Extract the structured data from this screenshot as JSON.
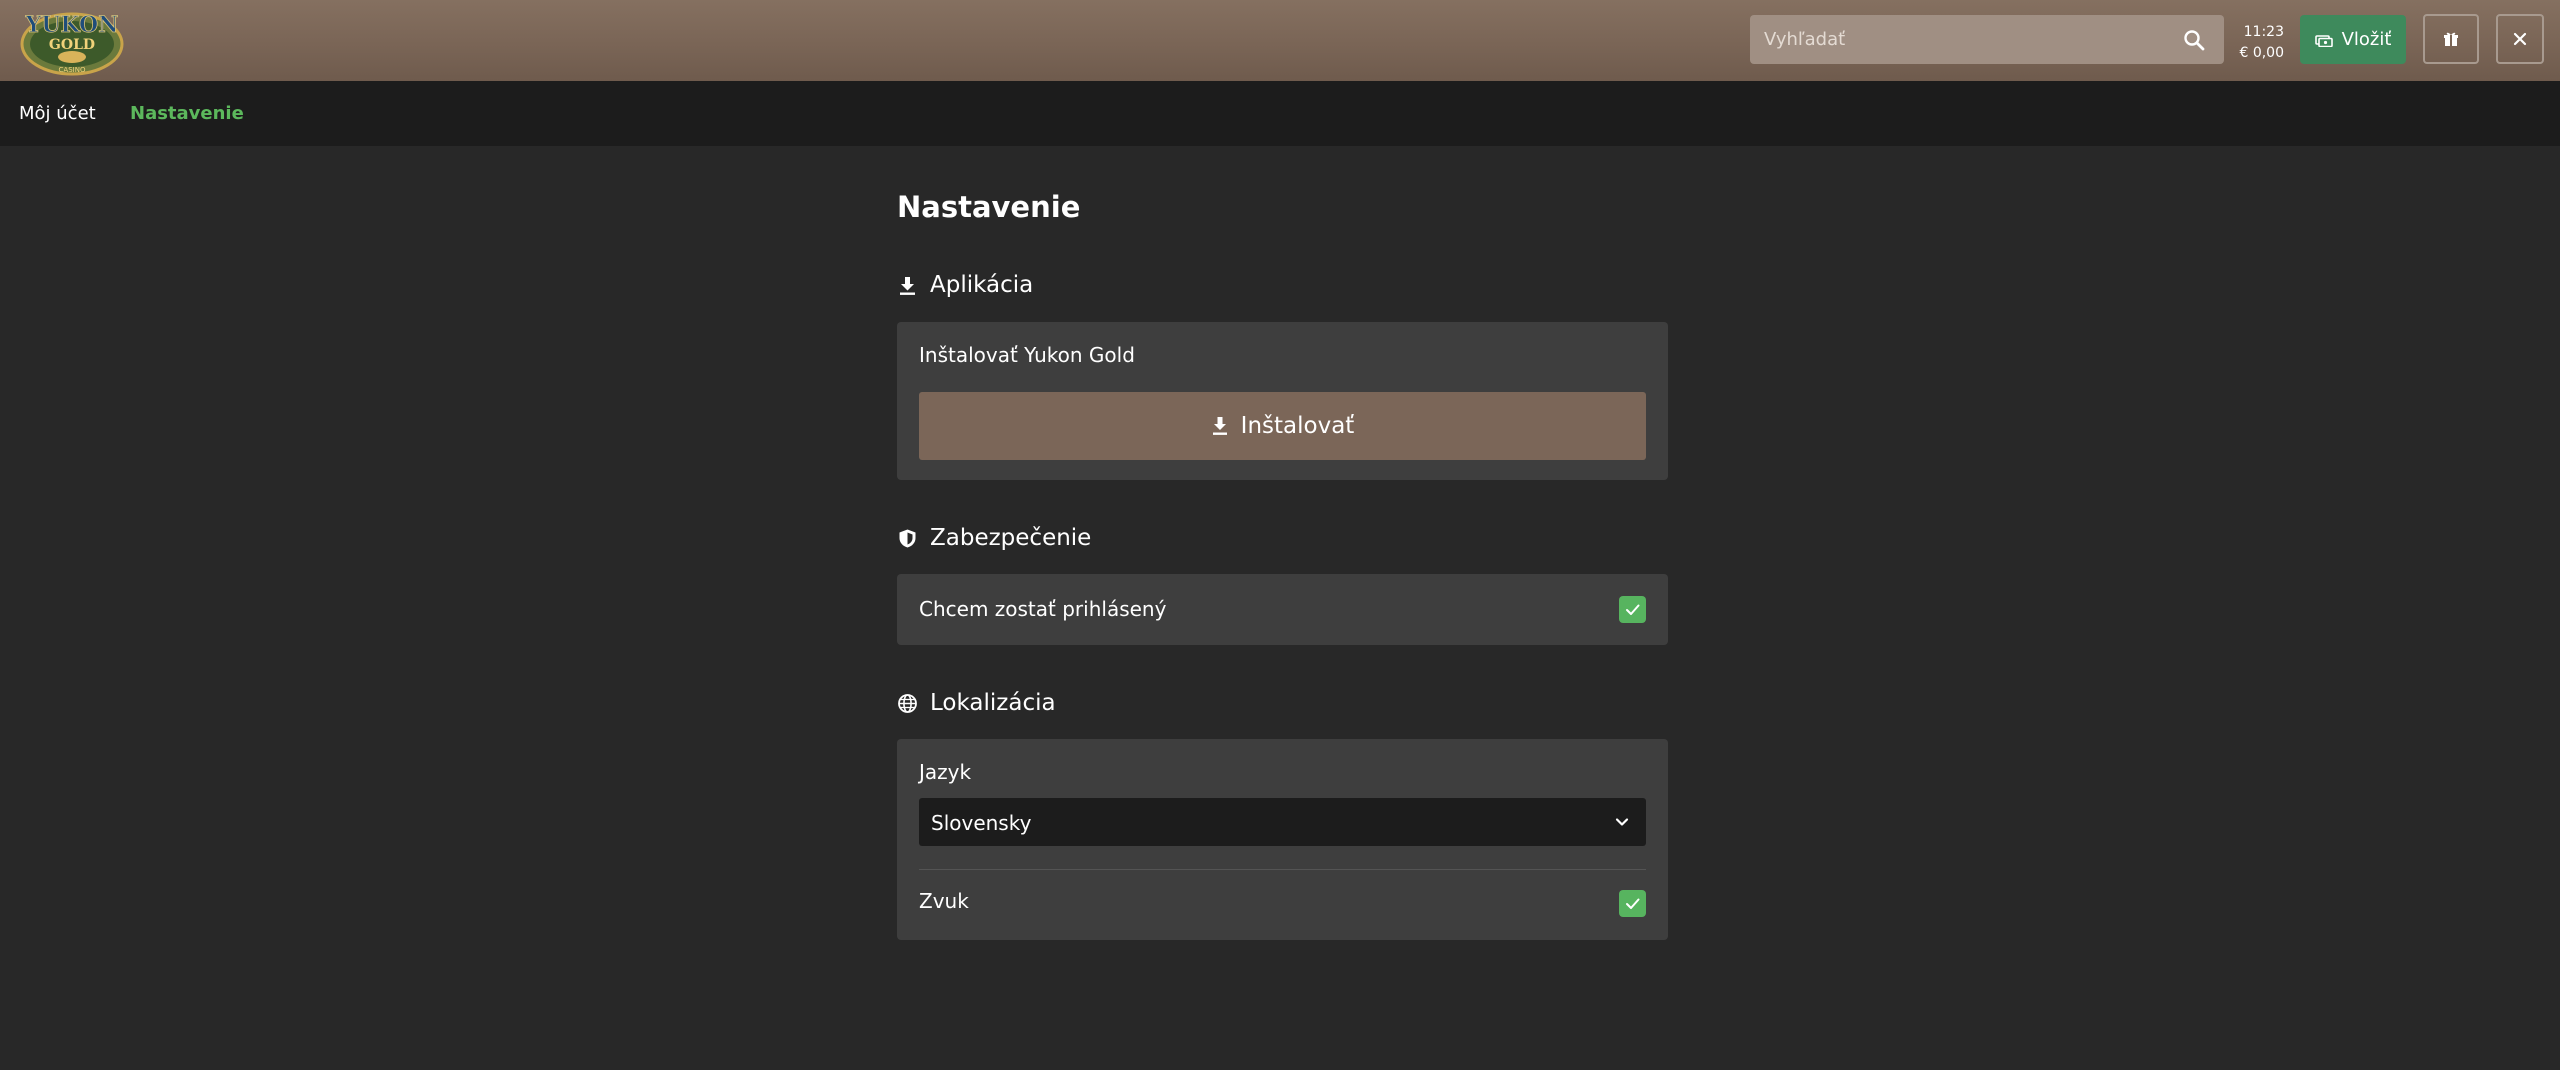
{
  "header": {
    "logo": {
      "text_line1": "YUKON",
      "text_line2": "GOLD",
      "text_line3": "CASINO",
      "icon": "yukon-gold-logo"
    },
    "search": {
      "placeholder": "Vyhľadať",
      "icon": "search-icon"
    },
    "time": "11:23",
    "balance": "€ 0,00",
    "deposit_label": "Vložiť",
    "deposit_icon": "cash-icon",
    "gift_icon": "gift-icon",
    "close_icon": "close-icon"
  },
  "subnav": {
    "items": [
      {
        "label": "Môj účet",
        "active": false
      },
      {
        "label": "Nastavenie",
        "active": true
      }
    ]
  },
  "main": {
    "title": "Nastavenie",
    "sections": [
      {
        "heading": "Aplikácia",
        "icon": "download-icon",
        "card_label": "Inštalovať Yukon Gold",
        "button_label": "Inštalovať",
        "button_icon": "download-icon"
      },
      {
        "heading": "Zabezpečenie",
        "icon": "shield-icon",
        "option_label": "Chcem zostať prihlásený",
        "checked": true
      },
      {
        "heading": "Lokalizácia",
        "icon": "globe-icon",
        "language_label": "Jazyk",
        "language_value": "Slovensky",
        "sound_label": "Zvuk",
        "sound_checked": true
      }
    ]
  },
  "colors": {
    "header_bg": "#7a6556",
    "subnav_bg": "#1c1c1c",
    "page_bg": "#282828",
    "card_bg": "#3e3e3e",
    "accent_green": "#5cb85c",
    "deposit_bg": "#3e8a5c",
    "install_bg": "#7b6658",
    "checkbox_bg": "#57b45f"
  }
}
